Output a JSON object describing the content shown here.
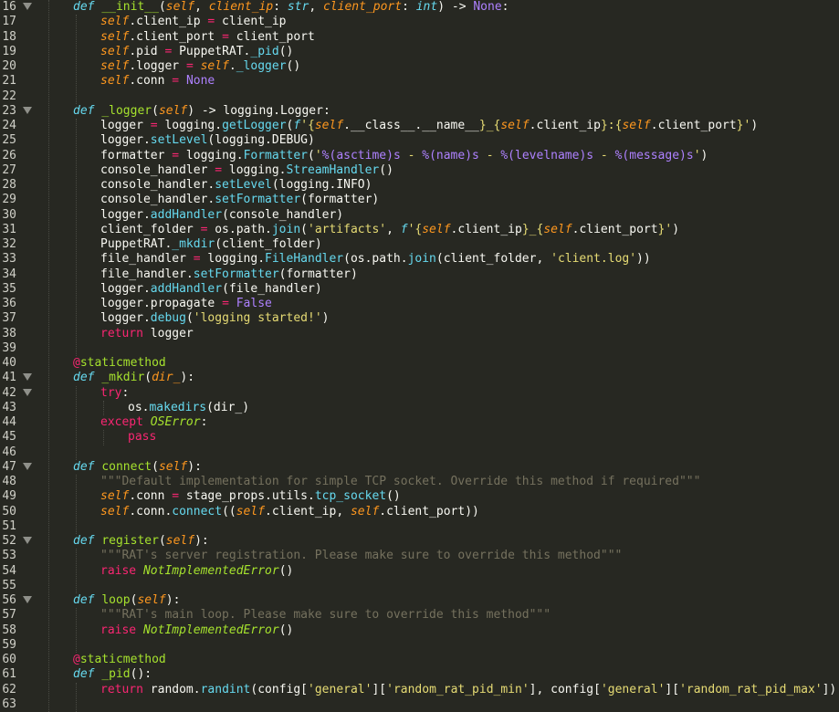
{
  "editor": {
    "lines": [
      {
        "n": "16",
        "fold": true,
        "indent": 0,
        "tokens": [
          [
            "kw",
            "def"
          ],
          [
            "plain",
            " "
          ],
          [
            "fn",
            "__init__"
          ],
          [
            "plain",
            "("
          ],
          [
            "self",
            "self"
          ],
          [
            "plain",
            ", "
          ],
          [
            "arg",
            "client_ip"
          ],
          [
            "plain",
            ": "
          ],
          [
            "type",
            "str"
          ],
          [
            "plain",
            ", "
          ],
          [
            "arg",
            "client_port"
          ],
          [
            "plain",
            ": "
          ],
          [
            "type",
            "int"
          ],
          [
            "plain",
            ") -> "
          ],
          [
            "const",
            "None"
          ],
          [
            "plain",
            ":"
          ]
        ]
      },
      {
        "n": "17",
        "indent": 1,
        "tokens": [
          [
            "self",
            "self"
          ],
          [
            "plain",
            ".client_ip "
          ],
          [
            "op",
            "="
          ],
          [
            "plain",
            " client_ip"
          ]
        ]
      },
      {
        "n": "18",
        "indent": 1,
        "tokens": [
          [
            "self",
            "self"
          ],
          [
            "plain",
            ".client_port "
          ],
          [
            "op",
            "="
          ],
          [
            "plain",
            " client_port"
          ]
        ]
      },
      {
        "n": "19",
        "indent": 1,
        "tokens": [
          [
            "self",
            "self"
          ],
          [
            "plain",
            ".pid "
          ],
          [
            "op",
            "="
          ],
          [
            "plain",
            " PuppetRAT."
          ],
          [
            "call",
            "_pid"
          ],
          [
            "plain",
            "()"
          ]
        ]
      },
      {
        "n": "20",
        "indent": 1,
        "tokens": [
          [
            "self",
            "self"
          ],
          [
            "plain",
            ".logger "
          ],
          [
            "op",
            "="
          ],
          [
            "plain",
            " "
          ],
          [
            "self",
            "self"
          ],
          [
            "plain",
            "."
          ],
          [
            "call",
            "_logger"
          ],
          [
            "plain",
            "()"
          ]
        ]
      },
      {
        "n": "21",
        "indent": 1,
        "tokens": [
          [
            "self",
            "self"
          ],
          [
            "plain",
            ".conn "
          ],
          [
            "op",
            "="
          ],
          [
            "plain",
            " "
          ],
          [
            "const",
            "None"
          ]
        ]
      },
      {
        "n": "22",
        "indent": 0,
        "tokens": []
      },
      {
        "n": "23",
        "fold": true,
        "indent": 0,
        "tokens": [
          [
            "kw",
            "def"
          ],
          [
            "plain",
            " "
          ],
          [
            "fn",
            "_logger"
          ],
          [
            "plain",
            "("
          ],
          [
            "self",
            "self"
          ],
          [
            "plain",
            ") -> logging.Logger:"
          ]
        ]
      },
      {
        "n": "24",
        "indent": 1,
        "tokens": [
          [
            "plain",
            "logger "
          ],
          [
            "op",
            "="
          ],
          [
            "plain",
            " logging."
          ],
          [
            "call",
            "getLogger"
          ],
          [
            "plain",
            "("
          ],
          [
            "kw",
            "f"
          ],
          [
            "str",
            "'{"
          ],
          [
            "self",
            "self"
          ],
          [
            "plain",
            ".__class__.__name__"
          ],
          [
            "str",
            "}_{"
          ],
          [
            "self",
            "self"
          ],
          [
            "plain",
            ".client_ip"
          ],
          [
            "str",
            "}:{"
          ],
          [
            "self",
            "self"
          ],
          [
            "plain",
            ".client_port"
          ],
          [
            "str",
            "}'"
          ],
          [
            "plain",
            ")"
          ]
        ]
      },
      {
        "n": "25",
        "indent": 1,
        "tokens": [
          [
            "plain",
            "logger."
          ],
          [
            "call",
            "setLevel"
          ],
          [
            "plain",
            "(logging.DEBUG)"
          ]
        ]
      },
      {
        "n": "26",
        "indent": 1,
        "tokens": [
          [
            "plain",
            "formatter "
          ],
          [
            "op",
            "="
          ],
          [
            "plain",
            " logging."
          ],
          [
            "call",
            "Formatter"
          ],
          [
            "plain",
            "("
          ],
          [
            "str",
            "'"
          ],
          [
            "fmt",
            "%(asctime)s"
          ],
          [
            "str",
            " - "
          ],
          [
            "fmt",
            "%(name)s"
          ],
          [
            "str",
            " - "
          ],
          [
            "fmt",
            "%(levelname)s"
          ],
          [
            "str",
            " - "
          ],
          [
            "fmt",
            "%(message)s"
          ],
          [
            "str",
            "'"
          ],
          [
            "plain",
            ")"
          ]
        ]
      },
      {
        "n": "27",
        "indent": 1,
        "tokens": [
          [
            "plain",
            "console_handler "
          ],
          [
            "op",
            "="
          ],
          [
            "plain",
            " logging."
          ],
          [
            "call",
            "StreamHandler"
          ],
          [
            "plain",
            "()"
          ]
        ]
      },
      {
        "n": "28",
        "indent": 1,
        "tokens": [
          [
            "plain",
            "console_handler."
          ],
          [
            "call",
            "setLevel"
          ],
          [
            "plain",
            "(logging.INFO)"
          ]
        ]
      },
      {
        "n": "29",
        "indent": 1,
        "tokens": [
          [
            "plain",
            "console_handler."
          ],
          [
            "call",
            "setFormatter"
          ],
          [
            "plain",
            "(formatter)"
          ]
        ]
      },
      {
        "n": "30",
        "indent": 1,
        "tokens": [
          [
            "plain",
            "logger."
          ],
          [
            "call",
            "addHandler"
          ],
          [
            "plain",
            "(console_handler)"
          ]
        ]
      },
      {
        "n": "31",
        "indent": 1,
        "tokens": [
          [
            "plain",
            "client_folder "
          ],
          [
            "op",
            "="
          ],
          [
            "plain",
            " os.path."
          ],
          [
            "call",
            "join"
          ],
          [
            "plain",
            "("
          ],
          [
            "str",
            "'artifacts'"
          ],
          [
            "plain",
            ", "
          ],
          [
            "kw",
            "f"
          ],
          [
            "str",
            "'{"
          ],
          [
            "self",
            "self"
          ],
          [
            "plain",
            ".client_ip"
          ],
          [
            "str",
            "}_{"
          ],
          [
            "self",
            "self"
          ],
          [
            "plain",
            ".client_port"
          ],
          [
            "str",
            "}'"
          ],
          [
            "plain",
            ")"
          ]
        ]
      },
      {
        "n": "32",
        "indent": 1,
        "tokens": [
          [
            "plain",
            "PuppetRAT."
          ],
          [
            "call",
            "_mkdir"
          ],
          [
            "plain",
            "(client_folder)"
          ]
        ]
      },
      {
        "n": "33",
        "indent": 1,
        "tokens": [
          [
            "plain",
            "file_handler "
          ],
          [
            "op",
            "="
          ],
          [
            "plain",
            " logging."
          ],
          [
            "call",
            "FileHandler"
          ],
          [
            "plain",
            "(os.path."
          ],
          [
            "call",
            "join"
          ],
          [
            "plain",
            "(client_folder, "
          ],
          [
            "str",
            "'client.log'"
          ],
          [
            "plain",
            "))"
          ]
        ]
      },
      {
        "n": "34",
        "indent": 1,
        "tokens": [
          [
            "plain",
            "file_handler."
          ],
          [
            "call",
            "setFormatter"
          ],
          [
            "plain",
            "(formatter)"
          ]
        ]
      },
      {
        "n": "35",
        "indent": 1,
        "tokens": [
          [
            "plain",
            "logger."
          ],
          [
            "call",
            "addHandler"
          ],
          [
            "plain",
            "(file_handler)"
          ]
        ]
      },
      {
        "n": "36",
        "indent": 1,
        "tokens": [
          [
            "plain",
            "logger.propagate "
          ],
          [
            "op",
            "="
          ],
          [
            "plain",
            " "
          ],
          [
            "const",
            "False"
          ]
        ]
      },
      {
        "n": "37",
        "indent": 1,
        "tokens": [
          [
            "plain",
            "logger."
          ],
          [
            "call",
            "debug"
          ],
          [
            "plain",
            "("
          ],
          [
            "str",
            "'logging started!'"
          ],
          [
            "plain",
            ")"
          ]
        ]
      },
      {
        "n": "38",
        "indent": 1,
        "tokens": [
          [
            "ctrl",
            "return"
          ],
          [
            "plain",
            " logger"
          ]
        ]
      },
      {
        "n": "39",
        "indent": 0,
        "tokens": []
      },
      {
        "n": "40",
        "indent": 0,
        "tokens": [
          [
            "dec",
            "@"
          ],
          [
            "decname",
            "staticmethod"
          ]
        ]
      },
      {
        "n": "41",
        "fold": true,
        "indent": 0,
        "tokens": [
          [
            "kw",
            "def"
          ],
          [
            "plain",
            " "
          ],
          [
            "fn",
            "_mkdir"
          ],
          [
            "plain",
            "("
          ],
          [
            "arg",
            "dir_"
          ],
          [
            "plain",
            "):"
          ]
        ]
      },
      {
        "n": "42",
        "fold": true,
        "indent": 1,
        "tokens": [
          [
            "ctrl",
            "try"
          ],
          [
            "plain",
            ":"
          ]
        ]
      },
      {
        "n": "43",
        "indent": 2,
        "tokens": [
          [
            "plain",
            "os."
          ],
          [
            "call",
            "makedirs"
          ],
          [
            "plain",
            "(dir_)"
          ]
        ]
      },
      {
        "n": "44",
        "indent": 1,
        "tokens": [
          [
            "ctrl",
            "except"
          ],
          [
            "plain",
            " "
          ],
          [
            "cls",
            "OSError"
          ],
          [
            "plain",
            ":"
          ]
        ]
      },
      {
        "n": "45",
        "indent": 2,
        "tokens": [
          [
            "ctrl",
            "pass"
          ]
        ]
      },
      {
        "n": "46",
        "indent": 0,
        "tokens": []
      },
      {
        "n": "47",
        "fold": true,
        "indent": 0,
        "tokens": [
          [
            "kw",
            "def"
          ],
          [
            "plain",
            " "
          ],
          [
            "fn",
            "connect"
          ],
          [
            "plain",
            "("
          ],
          [
            "self",
            "self"
          ],
          [
            "plain",
            "):"
          ]
        ]
      },
      {
        "n": "48",
        "indent": 1,
        "tokens": [
          [
            "doc",
            "\"\"\"Default implementation for simple TCP socket. Override this method if required\"\"\""
          ]
        ]
      },
      {
        "n": "49",
        "indent": 1,
        "tokens": [
          [
            "self",
            "self"
          ],
          [
            "plain",
            ".conn "
          ],
          [
            "op",
            "="
          ],
          [
            "plain",
            " stage_props.utils."
          ],
          [
            "call",
            "tcp_socket"
          ],
          [
            "plain",
            "()"
          ]
        ]
      },
      {
        "n": "50",
        "indent": 1,
        "tokens": [
          [
            "self",
            "self"
          ],
          [
            "plain",
            ".conn."
          ],
          [
            "call",
            "connect"
          ],
          [
            "plain",
            "(("
          ],
          [
            "self",
            "self"
          ],
          [
            "plain",
            ".client_ip, "
          ],
          [
            "self",
            "self"
          ],
          [
            "plain",
            ".client_port))"
          ]
        ]
      },
      {
        "n": "51",
        "indent": 0,
        "tokens": []
      },
      {
        "n": "52",
        "fold": true,
        "indent": 0,
        "tokens": [
          [
            "kw",
            "def"
          ],
          [
            "plain",
            " "
          ],
          [
            "fn",
            "register"
          ],
          [
            "plain",
            "("
          ],
          [
            "self",
            "self"
          ],
          [
            "plain",
            "):"
          ]
        ]
      },
      {
        "n": "53",
        "indent": 1,
        "tokens": [
          [
            "doc",
            "\"\"\"RAT's server registration. Please make sure to override this method\"\"\""
          ]
        ]
      },
      {
        "n": "54",
        "indent": 1,
        "tokens": [
          [
            "ctrl",
            "raise"
          ],
          [
            "plain",
            " "
          ],
          [
            "cls",
            "NotImplementedError"
          ],
          [
            "plain",
            "()"
          ]
        ]
      },
      {
        "n": "55",
        "indent": 0,
        "tokens": []
      },
      {
        "n": "56",
        "fold": true,
        "indent": 0,
        "tokens": [
          [
            "kw",
            "def"
          ],
          [
            "plain",
            " "
          ],
          [
            "fn",
            "loop"
          ],
          [
            "plain",
            "("
          ],
          [
            "self",
            "self"
          ],
          [
            "plain",
            "):"
          ]
        ]
      },
      {
        "n": "57",
        "indent": 1,
        "tokens": [
          [
            "doc",
            "\"\"\"RAT's main loop. Please make sure to override this method\"\"\""
          ]
        ]
      },
      {
        "n": "58",
        "indent": 1,
        "tokens": [
          [
            "ctrl",
            "raise"
          ],
          [
            "plain",
            " "
          ],
          [
            "cls",
            "NotImplementedError"
          ],
          [
            "plain",
            "()"
          ]
        ]
      },
      {
        "n": "59",
        "indent": 0,
        "tokens": []
      },
      {
        "n": "60",
        "indent": 0,
        "tokens": [
          [
            "dec",
            "@"
          ],
          [
            "decname",
            "staticmethod"
          ]
        ]
      },
      {
        "n": "61",
        "indent": 0,
        "tokens": [
          [
            "kw",
            "def"
          ],
          [
            "plain",
            " "
          ],
          [
            "fn",
            "_pid"
          ],
          [
            "plain",
            "():"
          ]
        ]
      },
      {
        "n": "62",
        "indent": 1,
        "tokens": [
          [
            "ctrl",
            "return"
          ],
          [
            "plain",
            " random."
          ],
          [
            "call",
            "randint"
          ],
          [
            "plain",
            "(config["
          ],
          [
            "str",
            "'general'"
          ],
          [
            "plain",
            "]["
          ],
          [
            "str",
            "'random_rat_pid_min'"
          ],
          [
            "plain",
            "], config["
          ],
          [
            "str",
            "'general'"
          ],
          [
            "plain",
            "]["
          ],
          [
            "str",
            "'random_rat_pid_max'"
          ],
          [
            "plain",
            "])"
          ]
        ]
      },
      {
        "n": "63",
        "indent": 0,
        "tokens": []
      }
    ],
    "colors": {
      "background": "#272822",
      "keyword": "#66d9ef",
      "control": "#f92672",
      "function": "#a6e22e",
      "self": "#fd971f",
      "string": "#e6db74",
      "constant": "#ae81ff",
      "comment": "#75715e",
      "text": "#f8f8f2"
    },
    "fold_icon": "fold-arrow-icon"
  }
}
